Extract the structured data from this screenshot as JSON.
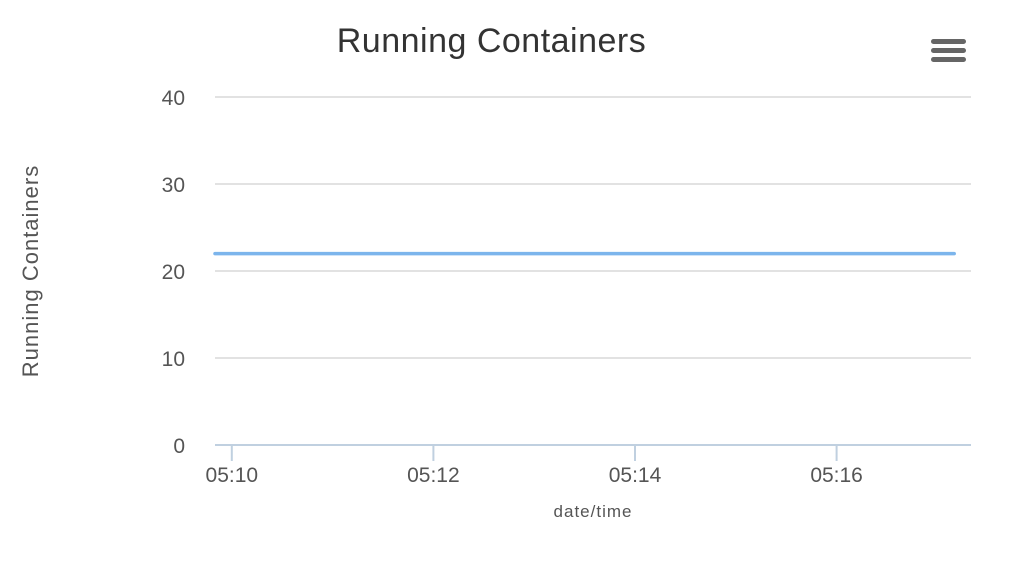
{
  "chart_data": {
    "type": "line",
    "title": "Running Containers",
    "xlabel": "date/time",
    "ylabel": "Running Containers",
    "ylim": [
      0,
      40
    ],
    "yticks": [
      0,
      10,
      20,
      30,
      40
    ],
    "xlim": [
      "05:09:50",
      "05:17:20"
    ],
    "xticks": [
      "05:10",
      "05:12",
      "05:14",
      "05:16"
    ],
    "grid": true,
    "series": [
      {
        "color": "#7cb5ec",
        "x": [
          "05:09:50",
          "05:17:10"
        ],
        "y": [
          22,
          22
        ]
      }
    ]
  },
  "menu": {
    "icon": "hamburger-menu-icon"
  }
}
